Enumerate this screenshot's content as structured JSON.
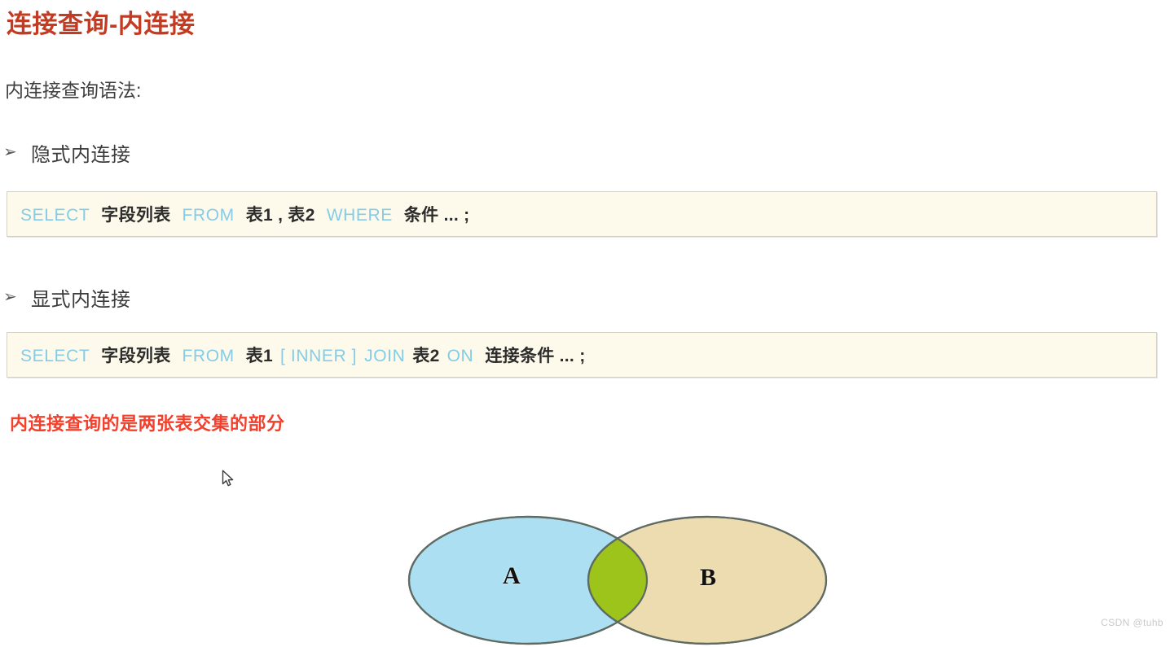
{
  "page": {
    "title": "连接查询-内连接",
    "title_color": "#c23b22",
    "intro": "内连接查询语法:",
    "note": "内连接查询的是两张表交集的部分",
    "note_color": "#f2402c",
    "background": "#ffffff"
  },
  "sections": [
    {
      "bullet": "➢",
      "label": "隐式内连接",
      "code": {
        "tokens": [
          {
            "text": "SELECT",
            "type": "keyword"
          },
          {
            "text": "字段列表",
            "type": "plain"
          },
          {
            "text": "FROM",
            "type": "keyword"
          },
          {
            "text": "表1 , 表2",
            "type": "plain"
          },
          {
            "text": "WHERE",
            "type": "keyword"
          },
          {
            "text": "条件 ... ;",
            "type": "plain"
          }
        ],
        "full_text": "SELECT 字段列表 FROM 表1 , 表2 WHERE 条件 ... ;"
      }
    },
    {
      "bullet": "➢",
      "label": "显式内连接",
      "code": {
        "tokens": [
          {
            "text": "SELECT",
            "type": "keyword"
          },
          {
            "text": "字段列表",
            "type": "plain"
          },
          {
            "text": "FROM",
            "type": "keyword"
          },
          {
            "text": "表1",
            "type": "plain"
          },
          {
            "text": "[ INNER ]",
            "type": "keyword"
          },
          {
            "text": "JOIN",
            "type": "keyword"
          },
          {
            "text": "表2",
            "type": "plain"
          },
          {
            "text": "ON",
            "type": "keyword"
          },
          {
            "text": "连接条件 ... ;",
            "type": "plain"
          }
        ],
        "full_text": "SELECT 字段列表 FROM 表1 [ INNER ] JOIN 表2 ON 连接条件 ... ;"
      }
    }
  ],
  "code_style": {
    "keyword_color": "#84cce8",
    "plain_color": "#2c2c2c",
    "background": "#fdfaeb",
    "border_color": "#d3d1c6"
  },
  "venn": {
    "left_label": "A",
    "right_label": "B",
    "left_fill": "#addff3",
    "right_fill": "#ecdcb0",
    "intersection_fill": "#9cc41b",
    "outline_color": "#5f6a63"
  },
  "watermark": "CSDN @tuhb"
}
